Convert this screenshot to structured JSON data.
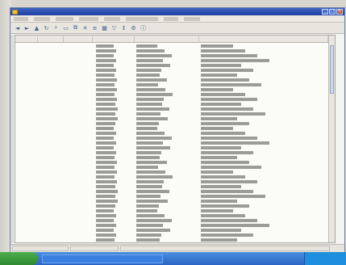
{
  "window": {
    "title": "",
    "buttons": [
      "_",
      "□",
      "×"
    ]
  },
  "menu": {
    "items": [
      "",
      "",
      "",
      "",
      "",
      "",
      "",
      ""
    ]
  },
  "toolbar": {
    "buttons": [
      {
        "name": "back-icon",
        "glyph": "◄"
      },
      {
        "name": "forward-icon",
        "glyph": "►"
      },
      {
        "name": "up-icon",
        "glyph": "▲"
      },
      {
        "name": "refresh-icon",
        "glyph": "↻"
      },
      {
        "name": "search-icon",
        "glyph": "⌕"
      },
      {
        "name": "folder-icon",
        "glyph": "▭"
      },
      {
        "name": "copy-icon",
        "glyph": "⧉"
      },
      {
        "name": "delete-icon",
        "glyph": "✕"
      },
      {
        "name": "properties-icon",
        "glyph": "≡"
      },
      {
        "name": "view-icon",
        "glyph": "▦"
      },
      {
        "name": "filter-icon",
        "glyph": "▽"
      },
      {
        "name": "sort-icon",
        "glyph": "↕"
      },
      {
        "name": "settings-icon",
        "glyph": "⚙"
      },
      {
        "name": "info-icon",
        "glyph": "ⓘ"
      }
    ]
  },
  "table": {
    "columns": [
      "",
      "",
      "",
      "",
      "",
      ""
    ],
    "row_count": 44
  },
  "statusbar": {
    "segments": [
      "",
      "",
      ""
    ]
  },
  "taskbar": {
    "start_label": "",
    "task_label": "",
    "clock": ""
  },
  "colors": {
    "titlebar": "#2a4fb0",
    "taskbar": "#2a66c4",
    "start": "#3c9c3c"
  }
}
